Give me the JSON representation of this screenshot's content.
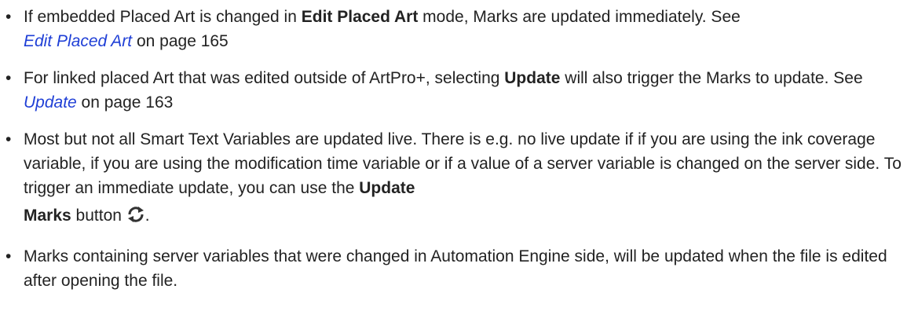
{
  "bullets": [
    {
      "t1": "If embedded Placed Art is changed in ",
      "b1": "Edit Placed Art",
      "t2": " mode, Marks are updated immediately. See",
      "link": "Edit Placed Art",
      "t3": " on page 165"
    },
    {
      "t1": "For linked placed Art that was edited outside of ArtPro+, selecting ",
      "b1": "Update",
      "t2": " will also trigger the Marks to update. See ",
      "link": "Update",
      "t3": " on page 163"
    },
    {
      "t1": "Most but not all Smart Text Variables are updated live. There is e.g. no live update if if you are using the ink coverage variable, if you are using the modification time variable or if a value of a server variable is changed on the server side. To trigger an immediate update, you can use the ",
      "b1": "Update",
      "b2": "Marks",
      "t2": " button ",
      "t3": ".",
      "icon": "refresh-icon"
    },
    {
      "t1": "Marks containing server variables that were changed in Automation Engine side, will be updated when the file is edited after opening the file."
    }
  ],
  "bullet_glyph": "•",
  "colors": {
    "text": "#222222",
    "link": "#1f3fd6"
  }
}
